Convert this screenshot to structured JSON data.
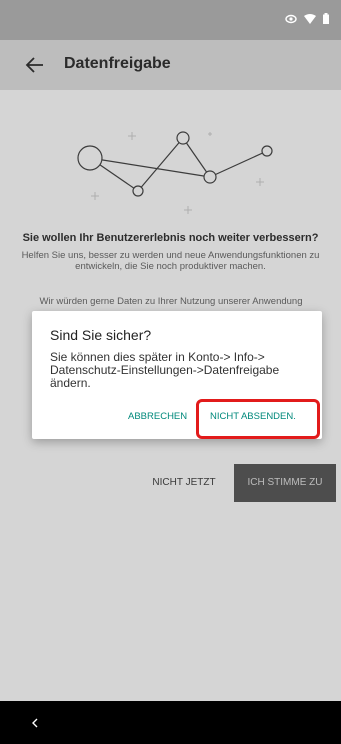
{
  "app_bar": {
    "title": "Datenfreigabe"
  },
  "icons": {
    "status": [
      "eye-icon",
      "wifi-icon",
      "battery-icon"
    ],
    "back": "arrow-left-icon",
    "nav_back": "chevron-left-icon"
  },
  "content": {
    "headline": "Sie wollen Ihr Benutzererlebnis noch weiter verbessern?",
    "intro": "Helfen Sie uns, besser zu werden und neue Anwendungsfunktionen zu entwickeln, die Sie noch produktiver machen.",
    "body_fragment": "Wir würden gerne Daten zu Ihrer Nutzung unserer Anwendung"
  },
  "actions": {
    "later_label": "NICHT JETZT",
    "agree_label": "ICH STIMME ZU"
  },
  "dialog": {
    "title": "Sind Sie sicher?",
    "message": "Sie können dies später in Konto-> Info-> Datenschutz-Einstellungen->Datenfreigabe ändern.",
    "cancel_label": "ABBRECHEN",
    "confirm_label": "NICHT ABSENDEN."
  },
  "colors": {
    "accent": "#00897b",
    "highlight": "#e21b1b"
  }
}
